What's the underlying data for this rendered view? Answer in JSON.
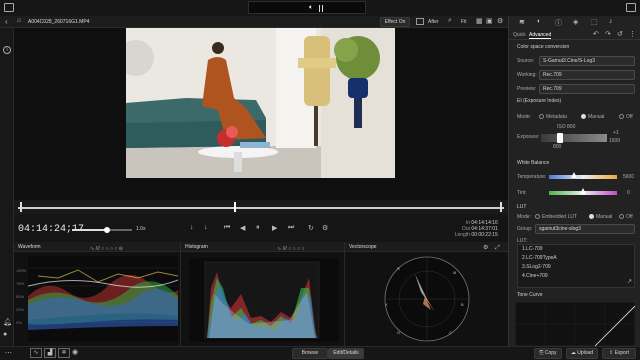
{
  "topbar": {
    "volume_icon": "speaker-icon"
  },
  "clip": {
    "filename": "A004C028_260716G1.MP4"
  },
  "viewer_toolbar": {
    "effect_label": "Effect On",
    "after_label": "After",
    "fit_label": "Fit"
  },
  "timecode": {
    "current": "04:14:24;17",
    "speed": "1.0x",
    "in_label": "In",
    "out_label": "Out",
    "length_label": "Length",
    "in_value": "04:14:14:16",
    "out_value": "04:14:37:01",
    "length_value": "00:00:22:15"
  },
  "scopes": {
    "waveform_title": "Waveform",
    "histogram_title": "Histogram",
    "vectorscope_title": "Vectorscope",
    "wave_ticks": [
      "100%",
      "75%",
      "50%",
      "25%",
      "0%"
    ]
  },
  "right_panel": {
    "tabs": [
      "Quick",
      "Advanced"
    ],
    "color_space": {
      "header": "Color space conversion",
      "source_label": "Source:",
      "source_value": "S-Gamut3.Cine/S-Log3",
      "working_label": "Working:",
      "working_value": "Rec.709",
      "preview_label": "Preview:",
      "preview_value": "Rec.709"
    },
    "ei": {
      "header": "EI (Exposure Index)",
      "mode_label": "Mode:",
      "opt_metadata": "Metadata",
      "opt_manual": "Manual",
      "opt_off": "Off",
      "exposure_label": "Exposure:",
      "iso": "ISO 800",
      "plus": "+1",
      "value": "1600",
      "iso2": "800"
    },
    "white_balance": {
      "header": "White Balance",
      "temp_label": "Temperature:",
      "temp_value": "5600",
      "tint_label": "Tint:",
      "tint_value": "0"
    },
    "lut": {
      "header": "LUT",
      "mode_label": "Mode:",
      "opt_embedded": "Embedded LUT",
      "opt_manual": "Manual",
      "opt_off": "Off",
      "group_label": "Group:",
      "group_value": "sgamut3cine-slog3",
      "lut_label": "LUT:",
      "items": [
        "1.LC-709",
        "2.LC-709TypeA",
        "3.SLog2-709",
        "4.Cine+709"
      ]
    },
    "tone_curve": {
      "header": "Tone Curve"
    }
  },
  "bottom": {
    "browse": "Browse",
    "edit": "Edit/Details",
    "copy": "Copy",
    "upload": "Upload",
    "export": "Export"
  }
}
